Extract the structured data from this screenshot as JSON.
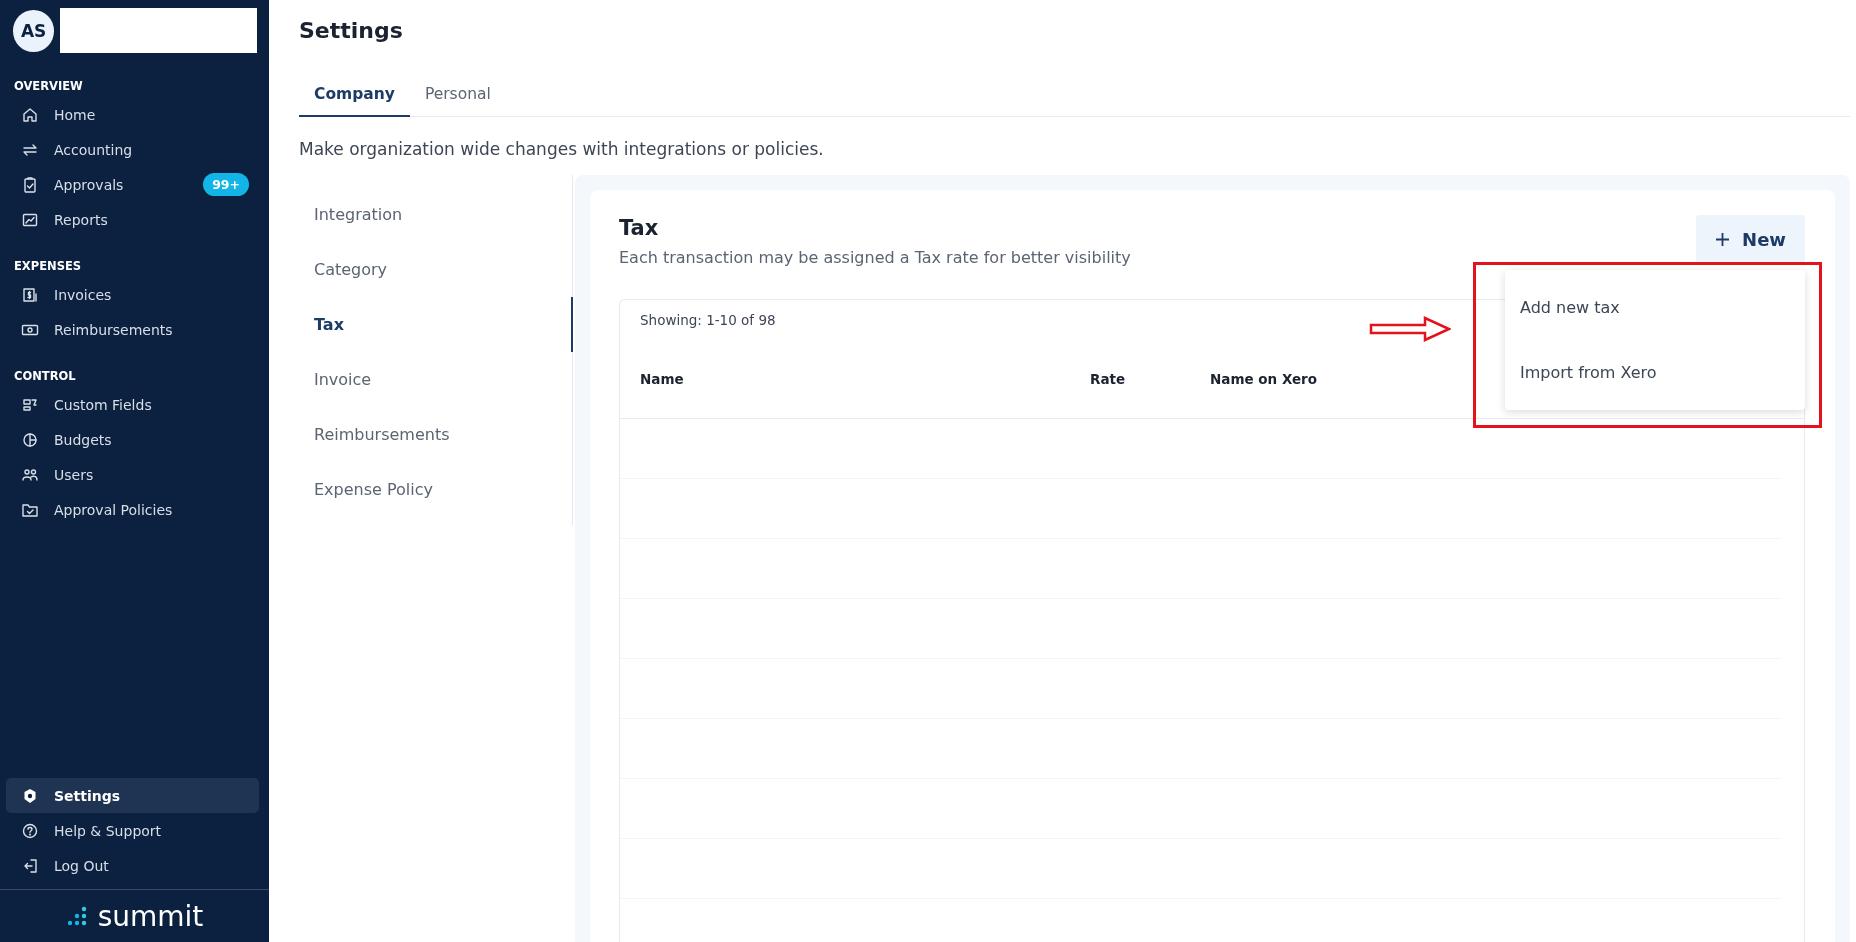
{
  "sidebar": {
    "avatar": {
      "initials": "AS"
    },
    "sections": [
      {
        "title": "OVERVIEW",
        "items": [
          {
            "label": "Home",
            "selected": false
          },
          {
            "label": "Accounting",
            "selected": false
          },
          {
            "label": "Approvals",
            "selected": false,
            "badge": "99+"
          },
          {
            "label": "Reports",
            "selected": false
          }
        ]
      },
      {
        "title": "EXPENSES",
        "items": [
          {
            "label": "Invoices",
            "selected": false
          },
          {
            "label": "Reimbursements",
            "selected": false
          }
        ]
      },
      {
        "title": "CONTROL",
        "items": [
          {
            "label": "Custom Fields",
            "selected": false
          },
          {
            "label": "Budgets",
            "selected": false
          },
          {
            "label": "Users",
            "selected": false
          },
          {
            "label": "Approval Policies",
            "selected": false
          }
        ]
      }
    ],
    "bottom_items": [
      {
        "label": "Settings",
        "selected": true
      },
      {
        "label": "Help & Support",
        "selected": false
      },
      {
        "label": "Log Out",
        "selected": false
      }
    ],
    "logo": {
      "text": "summit"
    }
  },
  "page": {
    "title": "Settings",
    "tabs": [
      {
        "label": "Company",
        "selected": true
      },
      {
        "label": "Personal",
        "selected": false
      }
    ],
    "description": "Make organization wide changes with integrations or policies."
  },
  "settings_nav": [
    {
      "label": "Integration",
      "selected": false
    },
    {
      "label": "Category",
      "selected": false
    },
    {
      "label": "Tax",
      "selected": true
    },
    {
      "label": "Invoice",
      "selected": false
    },
    {
      "label": "Reimbursements",
      "selected": false
    },
    {
      "label": "Expense Policy",
      "selected": false
    }
  ],
  "tax_panel": {
    "title": "Tax",
    "description": "Each transaction may be assigned a Tax rate for better visibility",
    "new_button": {
      "label": "New"
    },
    "dropdown": {
      "items": [
        "Add new tax",
        "Import from Xero"
      ]
    },
    "table": {
      "showing": "Showing: 1-10 of 98",
      "columns": [
        "Name",
        "Rate",
        "Name on Xero"
      ]
    }
  }
}
